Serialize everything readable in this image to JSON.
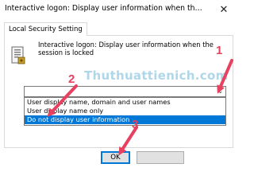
{
  "window": {
    "title": "Interactive logon: Display user information when the se...",
    "close_glyph": "✕"
  },
  "tab": {
    "label": "Local Security Setting"
  },
  "policy": {
    "description": "Interactive logon: Display user information when the session is locked",
    "icon": "policy-document-icon"
  },
  "dropdown": {
    "value": "",
    "arrow_glyph": "⌄",
    "options": [
      "User display name, domain and user names",
      "User display name only",
      "Do not display user information"
    ],
    "selected_index": 2
  },
  "buttons": {
    "ok": "OK",
    "cancel": ""
  },
  "watermark": "Thuthuattienich.com",
  "annotations": {
    "steps": [
      "1",
      "2",
      "3"
    ],
    "color": "#e8405f"
  },
  "colors": {
    "accent": "#0078d7",
    "selection_text": "#ffffff"
  }
}
